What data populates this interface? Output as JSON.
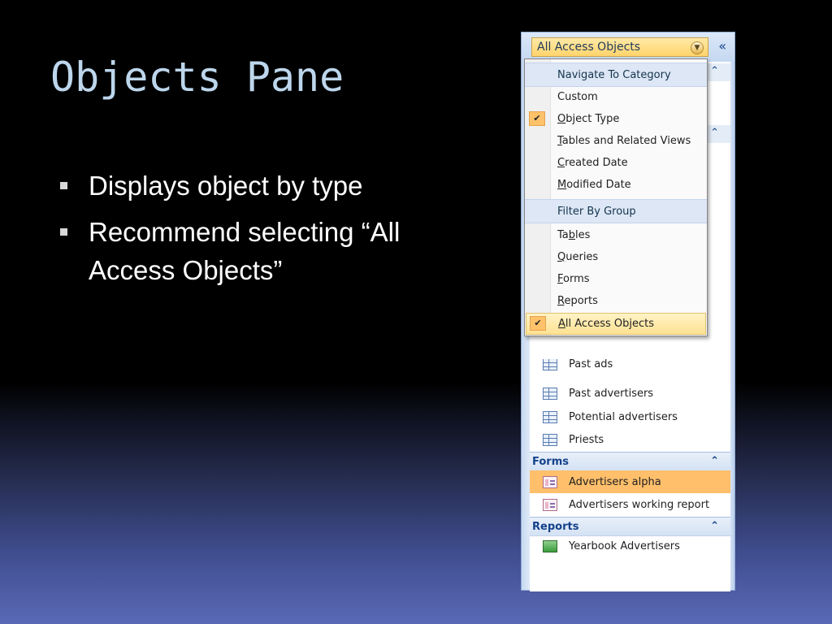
{
  "slide": {
    "title": "Objects Pane",
    "bullets": [
      "Displays object by type",
      "Recommend selecting “All Access Objects”"
    ]
  },
  "nav_pane": {
    "header_label": "All Access Objects",
    "collapse_glyph": "«",
    "groups": {
      "tables_partial": [
        "Past ads",
        "Past advertisers",
        "Potential advertisers",
        "Priests"
      ],
      "forms": {
        "label": "Forms",
        "items": [
          "Advertisers alpha",
          "Advertisers working report"
        ]
      },
      "reports": {
        "label": "Reports",
        "items": [
          "Yearbook Advertisers"
        ]
      }
    },
    "selected_item": "Advertisers alpha"
  },
  "menu": {
    "navigate_heading": "Navigate To Category",
    "navigate_items": [
      {
        "pre": "",
        "u": "",
        "post": "Custom",
        "checked": false
      },
      {
        "pre": "",
        "u": "O",
        "post": "bject Type",
        "checked": true
      },
      {
        "pre": "",
        "u": "T",
        "post": "ables and Related Views",
        "checked": false
      },
      {
        "pre": "",
        "u": "C",
        "post": "reated Date",
        "checked": false
      },
      {
        "pre": "",
        "u": "M",
        "post": "odified Date",
        "checked": false
      }
    ],
    "filter_heading": "Filter By Group",
    "filter_items": [
      {
        "pre": "Ta",
        "u": "b",
        "post": "les",
        "checked": false
      },
      {
        "pre": "",
        "u": "Q",
        "post": "ueries",
        "checked": false
      },
      {
        "pre": "",
        "u": "F",
        "post": "orms",
        "checked": false
      },
      {
        "pre": "",
        "u": "R",
        "post": "eports",
        "checked": false
      },
      {
        "pre": "",
        "u": "A",
        "post": "ll Access Objects",
        "checked": true
      }
    ],
    "check_glyph": "✔"
  },
  "colors": {
    "title": "#bdd6ec",
    "selection": "#ffbf6b",
    "group_header_text": "#15428b"
  }
}
